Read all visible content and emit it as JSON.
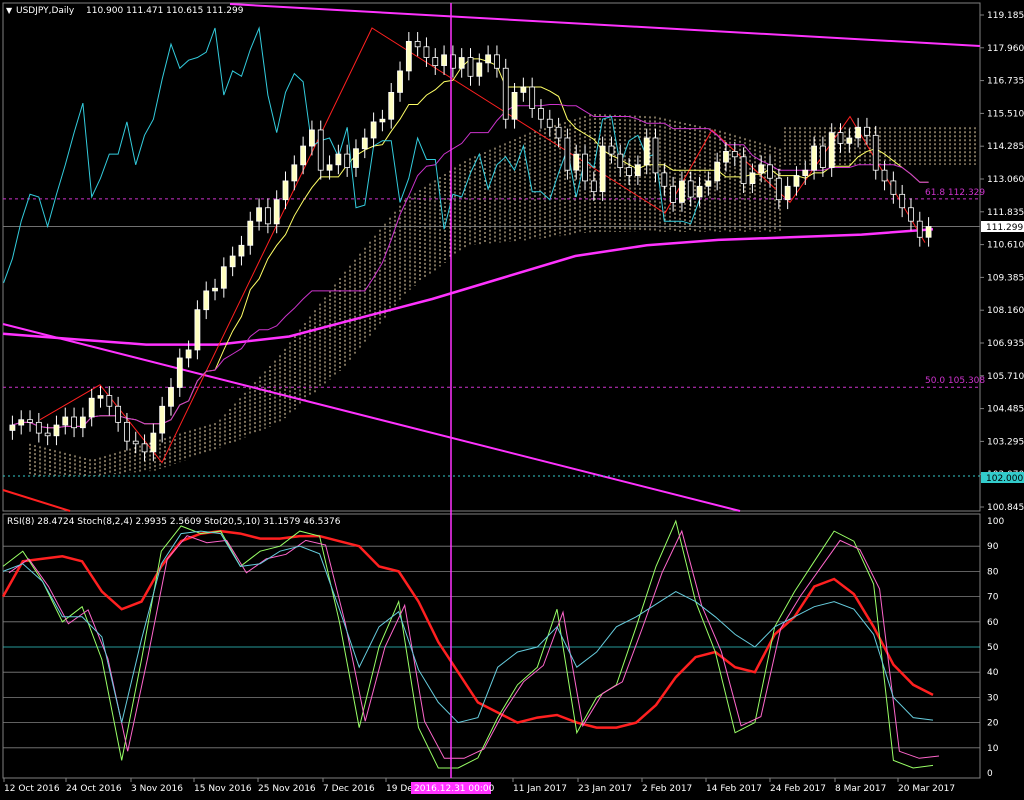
{
  "header": {
    "title": "USDJPY,Daily",
    "ohlc": "110.900 111.471 110.615 111.299",
    "indicator_line": "RSI(8) 28.4724  Stoch(8,2,4) 2.9935 2.5609  Sto(20,5,10) 31.1579 46.5376"
  },
  "colors": {
    "background": "#000000",
    "bull_candle": "#ffffc0",
    "bear_candle": "#ffffff",
    "tenkan": "#ffff66",
    "kijun": "#cc33cc",
    "chikou": "#33ccdd",
    "cloud": "#f5deb3",
    "sma": "#ff33ff",
    "trendline": "#ff33ff",
    "zigzag": "#ff2020",
    "fib": "#cc33cc",
    "rsi": "#ff2020",
    "stoch_fast_main": "#99ff66",
    "stoch_fast_signal": "#ff66cc",
    "stoch_slow_main": "#66ccdd",
    "grid": "#808080",
    "level50": "#33cccc"
  },
  "chart_data": [
    {
      "type": "line",
      "title": "USDJPY,Daily",
      "ylim": [
        100.3,
        119.8
      ],
      "y_ticks": [
        "119.185",
        "117.960",
        "116.735",
        "115.510",
        "114.285",
        "113.060",
        "111.835",
        "110.610",
        "109.385",
        "108.160",
        "106.935",
        "105.710",
        "104.485",
        "103.295",
        "102.070",
        "100.845"
      ],
      "x_ticks": [
        "12 Oct 2016",
        "24 Oct 2016",
        "3 Nov 2016",
        "15 Nov 2016",
        "25 Nov 2016",
        "7 Dec 2016",
        "19 Dec 2016",
        "11 Jan 2017",
        "23 Jan 2017",
        "2 Feb 2017",
        "14 Feb 2017",
        "24 Feb 2017",
        "8 Mar 2017",
        "20 Mar 2017"
      ],
      "price_label": "111.299",
      "horizontal_level_label": "102.000",
      "crosshair_date_label": "2016.12.31 00:00",
      "fib_levels": [
        {
          "label": "61.8 112.329",
          "value": 112.329
        },
        {
          "label": "50.0 105.308",
          "value": 105.308
        }
      ],
      "candles_close": [
        103.9,
        104.1,
        104.0,
        103.6,
        103.5,
        103.9,
        104.2,
        103.8,
        104.2,
        104.9,
        105.0,
        104.6,
        104.0,
        103.3,
        103.2,
        102.9,
        103.6,
        104.6,
        105.3,
        106.4,
        106.7,
        108.2,
        108.9,
        109.0,
        109.8,
        110.2,
        110.6,
        111.5,
        112.0,
        111.4,
        112.3,
        113.0,
        113.6,
        114.3,
        114.9,
        113.4,
        113.6,
        114.0,
        113.5,
        114.2,
        114.6,
        115.2,
        115.3,
        116.3,
        117.1,
        118.2,
        118.0,
        117.6,
        117.3,
        117.7,
        117.2,
        117.6,
        116.9,
        117.4,
        117.7,
        117.2,
        115.3,
        116.3,
        116.5,
        115.7,
        115.3,
        115.0,
        114.6,
        113.4,
        114.0,
        113.0,
        112.6,
        114.3,
        114.0,
        113.5,
        113.2,
        113.6,
        114.6,
        113.3,
        112.8,
        112.2,
        113.0,
        112.4,
        112.8,
        113.0,
        113.7,
        114.1,
        113.9,
        112.9,
        113.3,
        113.6,
        113.1,
        112.3,
        112.8,
        113.2,
        113.4,
        114.3,
        113.5,
        114.8,
        114.4,
        114.6,
        115.0,
        114.7,
        113.4,
        113.0,
        112.5,
        112.0,
        111.5,
        110.9,
        111.3
      ],
      "sma_series": [
        107.3,
        107.1,
        106.9,
        106.9,
        107.2,
        107.9,
        108.6,
        109.4,
        110.2,
        110.6,
        110.8,
        110.9,
        111.0,
        111.2
      ],
      "ichimoku_cloud": {
        "top": [
          103.2,
          102.6,
          103.3,
          104.0,
          106.5,
          109.5,
          112.3,
          113.8,
          114.8,
          115.5,
          115.4,
          114.9,
          114.2
        ],
        "bottom": [
          102.0,
          102.0,
          102.2,
          103.0,
          104.0,
          106.0,
          108.8,
          110.6,
          110.8,
          111.1,
          111.1,
          111.1,
          111.1
        ]
      }
    },
    {
      "type": "line",
      "title": "RSI(8) 28.4724  Stoch(8,2,4) 2.9935 2.5609  Sto(20,5,10) 31.1579 46.5376",
      "ylim": [
        0,
        100
      ],
      "levels": [
        10,
        20,
        30,
        40,
        50,
        60,
        70,
        80,
        90
      ],
      "y_ticks": [
        "100",
        "90",
        "80",
        "70",
        "60",
        "50",
        "40",
        "30",
        "20",
        "10",
        "0"
      ],
      "series": [
        {
          "name": "RSI(8)",
          "values": [
            70,
            84,
            85,
            86,
            84,
            72,
            65,
            68,
            82,
            92,
            95,
            96,
            95,
            93,
            93,
            94,
            94,
            92,
            90,
            82,
            80,
            68,
            52,
            40,
            28,
            24,
            20,
            22,
            23,
            20,
            18,
            18,
            20,
            27,
            38,
            46,
            48,
            42,
            40,
            55,
            62,
            74,
            77,
            71,
            58,
            43,
            35,
            31
          ]
        },
        {
          "name": "Stoch(8,2,4)",
          "values": [
            82,
            88,
            76,
            60,
            66,
            45,
            5,
            45,
            88,
            98,
            95,
            96,
            82,
            88,
            90,
            96,
            94,
            60,
            18,
            50,
            68,
            18,
            2,
            2,
            6,
            22,
            35,
            42,
            65,
            16,
            30,
            35,
            58,
            82,
            100,
            68,
            48,
            16,
            20,
            58,
            72,
            84,
            96,
            92,
            75,
            5,
            2,
            3
          ]
        },
        {
          "name": "Sto(20,5,10)",
          "values": [
            80,
            83,
            76,
            62,
            62,
            54,
            20,
            53,
            83,
            95,
            96,
            95,
            82,
            83,
            88,
            90,
            87,
            65,
            42,
            58,
            64,
            41,
            28,
            20,
            22,
            42,
            48,
            50,
            58,
            42,
            48,
            58,
            62,
            67,
            72,
            68,
            62,
            55,
            50,
            58,
            62,
            66,
            68,
            65,
            55,
            30,
            22,
            21
          ]
        }
      ]
    }
  ]
}
